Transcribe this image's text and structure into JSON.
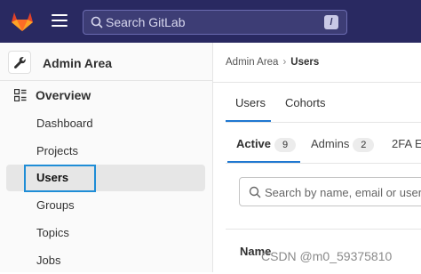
{
  "topbar": {
    "search_placeholder": "Search GitLab",
    "search_shortcut": "/",
    "colors": {
      "background": "#292961",
      "logo": "#e24329"
    },
    "icons": [
      "gitlab-logo",
      "hamburger-menu-icon",
      "search-icon"
    ]
  },
  "sidebar": {
    "title": "Admin Area",
    "section": "Overview",
    "items": [
      {
        "label": "Dashboard"
      },
      {
        "label": "Projects"
      },
      {
        "label": "Users",
        "active": true
      },
      {
        "label": "Groups"
      },
      {
        "label": "Topics"
      },
      {
        "label": "Jobs"
      }
    ]
  },
  "breadcrumb": {
    "parent": "Admin Area",
    "current": "Users"
  },
  "tabs": [
    {
      "label": "Users",
      "active": true
    },
    {
      "label": "Cohorts"
    }
  ],
  "user_tabs": [
    {
      "label": "Active",
      "count": "9",
      "active": true
    },
    {
      "label": "Admins",
      "count": "2"
    },
    {
      "label": "2FA E"
    }
  ],
  "filter": {
    "placeholder": "Search by name, email or user"
  },
  "table": {
    "columns": [
      "Name"
    ]
  },
  "watermark": "CSDN @m0_59375810"
}
